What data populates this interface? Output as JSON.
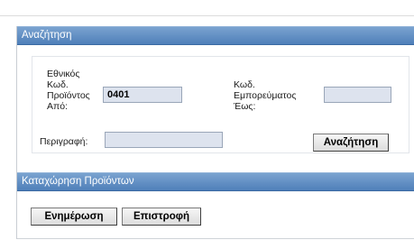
{
  "search_panel": {
    "title": "Αναζήτηση",
    "national_code_label": "Εθνικός\nΚωδ.\nΠροϊόντος\nΑπό:",
    "national_code_value": "0401",
    "trade_code_label": "Κωδ.\nΕμπορεύματος\nΈως:",
    "trade_code_value": "",
    "description_label": "Περιγραφή:",
    "description_value": "",
    "search_button": "Αναζήτηση"
  },
  "registration_panel": {
    "title": "Καταχώρηση Προϊόντων",
    "update_button": "Ενημέρωση",
    "back_button": "Επιστροφή"
  }
}
